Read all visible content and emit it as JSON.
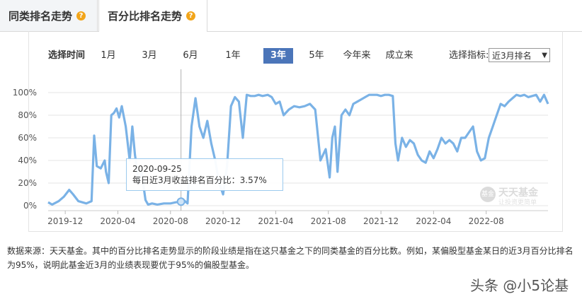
{
  "tabs": [
    {
      "label": "同类排名走势",
      "icon": "question-icon"
    },
    {
      "label": "百分比排名走势",
      "icon": "question-icon"
    }
  ],
  "controls": {
    "label": "选择时间",
    "ranges": [
      "1月",
      "3月",
      "6月",
      "1年",
      "3年",
      "5年",
      "今年来",
      "成立来"
    ],
    "active_range": "3年",
    "indicator_label": "选择指标:",
    "indicator_value": "近3月排名"
  },
  "tooltip": {
    "date": "2020-09-25",
    "text": "每日近3月收益排名百分比：3.57%"
  },
  "watermark": {
    "title": "天天基金",
    "subtitle": "让投资更简单"
  },
  "note": "数据来源：天天基金。其中的百分比排名走势显示的阶段业绩是指在这只基金之下的同类基金的百分比数。例如，某偏股型基金某日的近3月百分比排名为95%，说明此基金近3月的业绩表现要优于95%的偏股型基金。",
  "credit": "头条 @小5论基",
  "colors": {
    "line": "#7ab2e6",
    "active": "#4b75b9",
    "question": "#f2a51a"
  },
  "chart_data": {
    "type": "line",
    "y_ticks": [
      "100%",
      "80%",
      "60%",
      "40%",
      "20%",
      "0%"
    ],
    "ylim": [
      0,
      100
    ],
    "x_ticks": [
      "2019-12",
      "2020-04",
      "2020-08",
      "2020-12",
      "2021-04",
      "2021-08",
      "2021-12",
      "2022-04",
      "2022-08"
    ],
    "x_tick_positions": [
      0.0,
      4.0,
      8.0,
      12.0,
      16.0,
      20.0,
      24.0,
      28.0,
      32.0
    ],
    "xlim": [
      -1.3,
      36.7
    ],
    "crosshair_x": 8.8,
    "series": [
      {
        "x": [
          -1.3,
          -1.0,
          -0.5,
          -0.1,
          0.3,
          0.6,
          1.0,
          1.3,
          1.6,
          2.0,
          2.2,
          2.4,
          2.7,
          3.0,
          3.1,
          3.3,
          3.5,
          3.7,
          3.9,
          4.1,
          4.3,
          4.6,
          4.9,
          5.1,
          5.3,
          5.6,
          5.8,
          6.1,
          6.3,
          6.6,
          7.0,
          7.5,
          8.0,
          8.4,
          8.8,
          9.0,
          9.3,
          9.6,
          9.9,
          10.2,
          10.5,
          10.8,
          11.1,
          11.4,
          11.7,
          12.0,
          12.3,
          12.6,
          12.9,
          13.2,
          13.5,
          13.8,
          14.1,
          14.4,
          14.7,
          15.0,
          15.4,
          15.7,
          16.0,
          16.3,
          16.6,
          17.0,
          17.4,
          17.8,
          18.2,
          18.6,
          19.0,
          19.4,
          19.8,
          20.1,
          20.3,
          20.5,
          20.7,
          21.0,
          21.3,
          21.6,
          21.9,
          22.2,
          22.5,
          22.8,
          23.1,
          23.4,
          23.7,
          24.0,
          24.3,
          24.6,
          24.9,
          25.1,
          25.3,
          25.6,
          25.9,
          26.2,
          26.5,
          26.8,
          27.1,
          27.4,
          27.7,
          28.0,
          28.3,
          28.6,
          28.9,
          29.2,
          29.5,
          29.8,
          30.1,
          30.4,
          30.7,
          31.0,
          31.3,
          31.6,
          31.9,
          32.2,
          32.5,
          32.8,
          33.1,
          33.4,
          33.7,
          34.0,
          34.3,
          34.6,
          34.9,
          35.2,
          35.5,
          35.8,
          36.1,
          36.4,
          36.7
        ],
        "y": [
          3,
          1,
          4,
          8,
          14,
          10,
          4,
          3,
          2,
          4,
          62,
          35,
          33,
          40,
          30,
          20,
          80,
          82,
          86,
          78,
          88,
          70,
          40,
          70,
          45,
          20,
          30,
          5,
          1,
          2,
          1,
          2,
          2,
          3,
          3.57,
          5,
          2,
          70,
          95,
          70,
          60,
          75,
          55,
          40,
          20,
          10,
          35,
          88,
          96,
          92,
          60,
          98,
          97,
          97,
          98,
          97,
          98,
          96,
          90,
          92,
          80,
          85,
          88,
          87,
          88,
          90,
          85,
          40,
          50,
          25,
          60,
          70,
          30,
          80,
          85,
          80,
          90,
          92,
          94,
          96,
          98,
          98,
          98,
          97,
          98,
          98,
          97,
          55,
          40,
          60,
          52,
          58,
          55,
          45,
          40,
          38,
          48,
          42,
          50,
          60,
          55,
          58,
          55,
          48,
          60,
          60,
          65,
          70,
          48,
          40,
          42,
          60,
          70,
          80,
          90,
          88,
          92,
          95,
          98,
          97,
          98,
          96,
          97,
          98,
          92,
          98,
          90
        ]
      }
    ]
  }
}
